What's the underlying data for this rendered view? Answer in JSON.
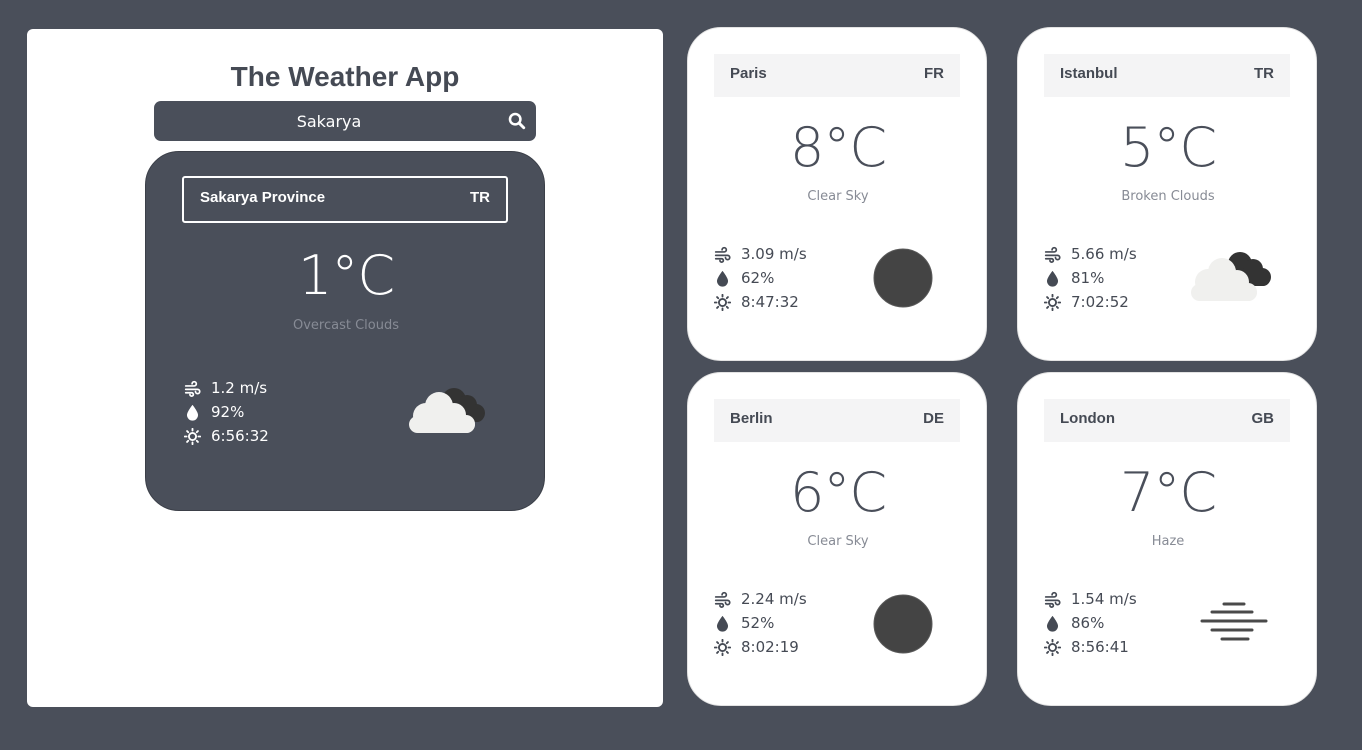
{
  "app": {
    "title": "The Weather App"
  },
  "search": {
    "value": "Sakarya",
    "icon": "search-icon"
  },
  "main": {
    "city": "Sakarya Province",
    "country": "TR",
    "temp": "1°C",
    "description": "Overcast Clouds",
    "wind": "1.2 m/s",
    "humidity": "92%",
    "sunrise": "6:56:32",
    "icon": "overcast-clouds-icon"
  },
  "cities": [
    {
      "city": "Paris",
      "country": "FR",
      "temp": "8°C",
      "description": "Clear Sky",
      "wind": "3.09 m/s",
      "humidity": "62%",
      "sunrise": "8:47:32",
      "icon": "clear-sky-icon"
    },
    {
      "city": "Istanbul",
      "country": "TR",
      "temp": "5°C",
      "description": "Broken Clouds",
      "wind": "5.66 m/s",
      "humidity": "81%",
      "sunrise": "7:02:52",
      "icon": "broken-clouds-icon"
    },
    {
      "city": "Berlin",
      "country": "DE",
      "temp": "6°C",
      "description": "Clear Sky",
      "wind": "2.24 m/s",
      "humidity": "52%",
      "sunrise": "8:02:19",
      "icon": "clear-sky-icon"
    },
    {
      "city": "London",
      "country": "GB",
      "temp": "7°C",
      "description": "Haze",
      "wind": "1.54 m/s",
      "humidity": "86%",
      "sunrise": "8:56:41",
      "icon": "haze-icon"
    }
  ],
  "colors": {
    "background": "#4a4f5a",
    "card": "#ffffff",
    "text_dark": "#454a54",
    "muted": "#878b95"
  }
}
